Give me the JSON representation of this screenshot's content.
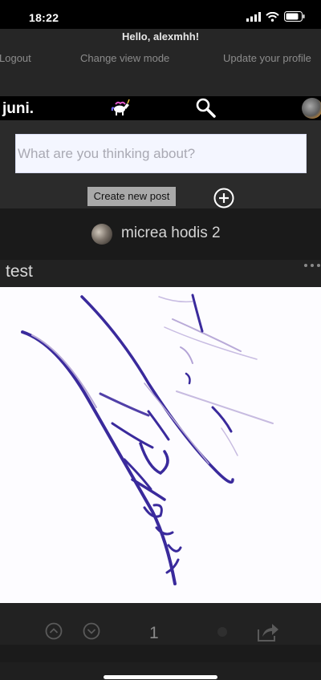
{
  "status_bar": {
    "time": "18:22"
  },
  "header": {
    "greeting": "Hello, alexmhh!",
    "nav": {
      "logout": "Logout",
      "change_view": "Change view mode",
      "update_profile": "Update your profile"
    }
  },
  "app_bar": {
    "logo": "juni."
  },
  "composer": {
    "placeholder": "What are you thinking about?",
    "value": "",
    "create_label": "Create new post"
  },
  "post": {
    "author": "micrea hodis 2",
    "title": "test",
    "votes": "1"
  },
  "icons": {
    "unicorn": "unicorn-icon",
    "search": "search-icon",
    "add": "add-circle-icon",
    "more": "more-dots-icon",
    "upvote": "chevron-up-circle-icon",
    "downvote": "chevron-down-circle-icon",
    "share": "share-icon"
  },
  "colors": {
    "background": "#1b1b1b",
    "input_bg": "#f4f6ff",
    "button_bg": "#a9a9a9",
    "ink": "#3a2a9c"
  }
}
